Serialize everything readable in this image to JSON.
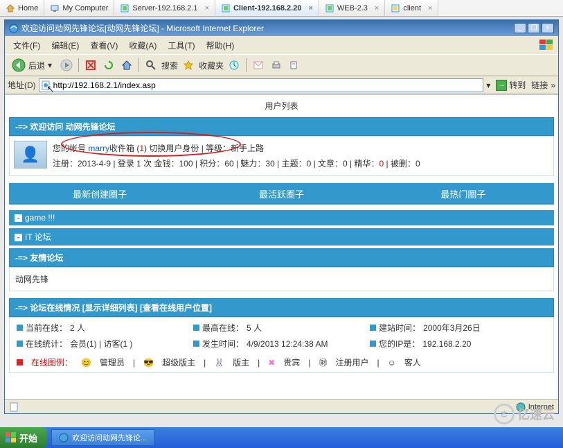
{
  "vmtabs": [
    {
      "label": "Home",
      "icon": "home"
    },
    {
      "label": "My Computer",
      "icon": "computer"
    },
    {
      "label": "Server-192.168.2.1",
      "icon": "vm"
    },
    {
      "label": "Client-192.168.2.20",
      "icon": "vm",
      "active": true
    },
    {
      "label": "WEB-2.3",
      "icon": "vm"
    },
    {
      "label": "client",
      "icon": "vm"
    }
  ],
  "ie": {
    "title": "欢迎访问动网先锋论坛[动网先锋论坛] - Microsoft Internet Explorer",
    "menus": [
      "文件(F)",
      "编辑(E)",
      "查看(V)",
      "收藏(A)",
      "工具(T)",
      "帮助(H)"
    ],
    "back": "后退",
    "search": "搜索",
    "favorites": "收藏夹",
    "address_label": "地址(D)",
    "address": "http://192.168.2.1/index.asp",
    "go": "转到",
    "links": "链接",
    "status_zone": "Internet"
  },
  "page": {
    "userlist": "用户列表",
    "welcome_bar": "-=> 欢迎访问 动网先锋论坛",
    "user_line1_a": "您的帐号 ",
    "user_name": "marry",
    "user_line1_b": "收件箱 (",
    "inbox_count": "1",
    "user_line1_c": ") 切换用户身份 | 等级：新手上路",
    "user_line2_a": "注册：2013-4-9 | 登录 1 次 金钱：100 | 积分：60 | 魅力：30 | 主题：0 | 文章：0 | 精华：",
    "elite": "0",
    "user_line2_b": " | 被删：0",
    "tabs": [
      "最新创建圈子",
      "最活跃圈子",
      "最热门圈子"
    ],
    "sect_game": "game !!!",
    "sect_it": "IT 论坛",
    "sect_friend": "-=> 友情论坛",
    "friend_content": "动网先锋",
    "online_bar_a": "-=> 论坛在线情况 ",
    "online_bar_b": "[显示详细列表]",
    "online_bar_c": " [查看在线用户位置]",
    "stats": {
      "now_online_l": "当前在线：",
      "now_online_v": "2 人",
      "max_online_l": "最高在线：",
      "max_online_v": "5 人",
      "site_time_l": "建站时间：",
      "site_time_v": "2000年3月26日",
      "online_stat_l": "在线统计：",
      "online_stat_v": "会员(1) | 访客(1 )",
      "happen_l": "发生时间：",
      "happen_v": "4/9/2013 12:24:38 AM",
      "ip_l": "您的IP是：",
      "ip_v": "192.168.2.20"
    },
    "legend_label": "在线图例：",
    "legend": [
      "管理员",
      "超级版主",
      "版主",
      "贵宾",
      "注册用户",
      "客人"
    ]
  },
  "taskbar": {
    "start": "开始",
    "task1": "欢迎访问动网先锋论..."
  },
  "watermark": "亿速云"
}
